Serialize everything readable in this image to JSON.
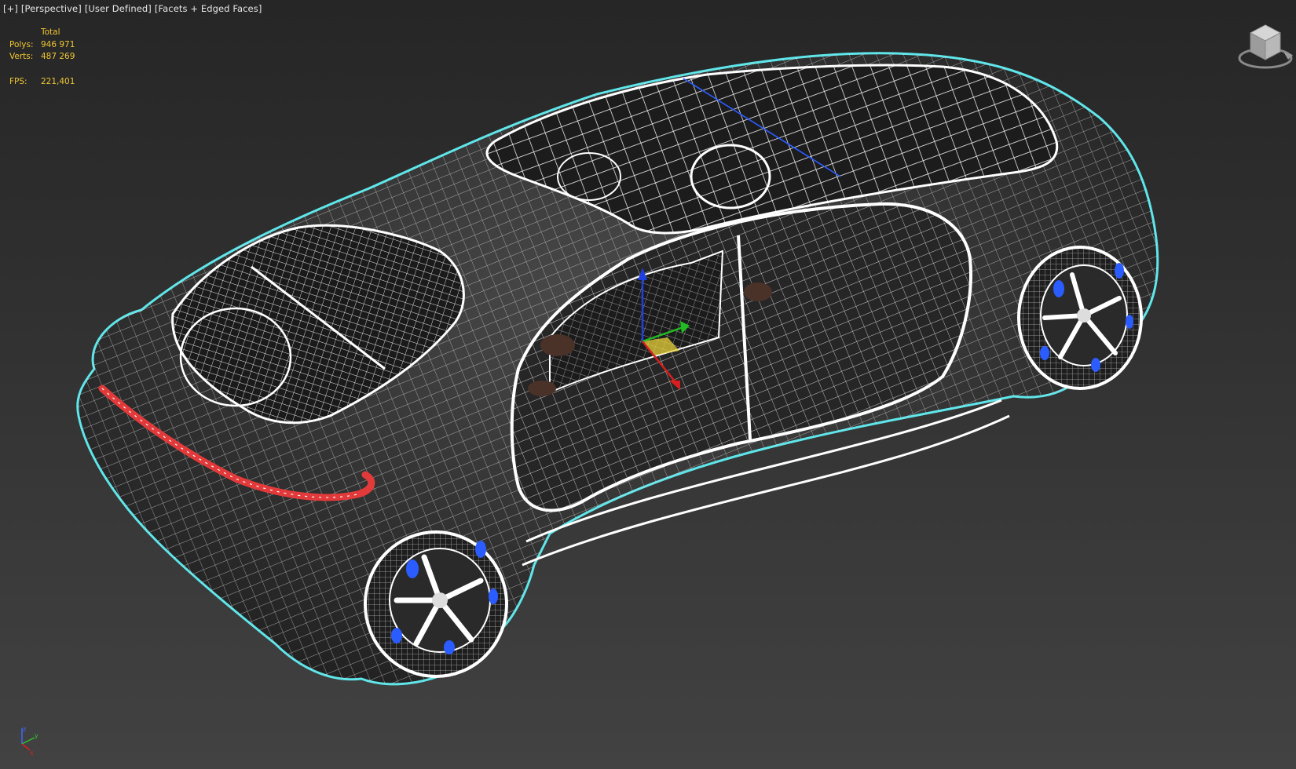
{
  "viewport": {
    "menu_plus": "[+]",
    "menu_view": "[Perspective]",
    "menu_shading_mode": "[User Defined]",
    "menu_display": "[Facets + Edged Faces]"
  },
  "stats": {
    "header": "Total",
    "polys_label": "Polys:",
    "polys_value": "946 971",
    "verts_label": "Verts:",
    "verts_value": "487 269",
    "fps_label": "FPS:",
    "fps_value": "221,401"
  },
  "icons": {
    "viewcube": "viewcube-icon",
    "gizmo": "transform-gizmo-icon",
    "axis_tripod": "axis-tripod-icon"
  },
  "colors": {
    "background_top": "#262626",
    "background_bottom": "#424242",
    "stats_text": "#f0c632",
    "selection_outline": "#5ee6ea",
    "wireframe": "#ffffff",
    "taillight": "#e23a3a",
    "wheel_accent": "#2a5cff",
    "gizmo_x": "#d81f1f",
    "gizmo_y": "#22bb22",
    "gizmo_z": "#1f3fe0"
  }
}
